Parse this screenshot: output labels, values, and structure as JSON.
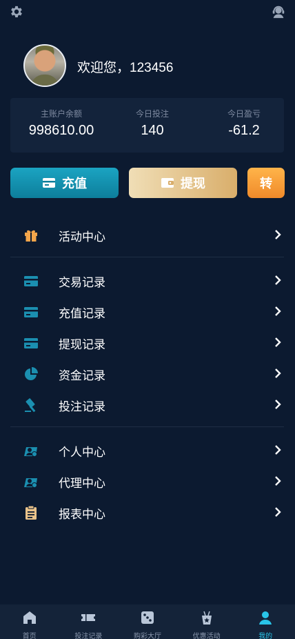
{
  "colors": {
    "background": "#0c1a30",
    "card": "#13233b",
    "accent_teal": "#1ba4c2",
    "gold": "#d9ae6b",
    "orange": "#f08a2a",
    "tab_active": "#29c4e8"
  },
  "header": {
    "settings_icon": "gear-icon",
    "support_icon": "customer-service-icon"
  },
  "profile": {
    "welcome": "欢迎您，123456"
  },
  "stats": [
    {
      "label": "主账户余额",
      "value": "998610.00"
    },
    {
      "label": "今日投注",
      "value": "140"
    },
    {
      "label": "今日盈亏",
      "value": "-61.2"
    }
  ],
  "actions": {
    "recharge": "充值",
    "withdraw": "提现",
    "transfer": "转"
  },
  "menu": [
    {
      "label": "活动中心",
      "icon": "gift-icon"
    },
    {
      "label": "交易记录",
      "icon": "card-icon"
    },
    {
      "label": "充值记录",
      "icon": "card-icon"
    },
    {
      "label": "提现记录",
      "icon": "card-icon"
    },
    {
      "label": "资金记录",
      "icon": "pie-chart-icon"
    },
    {
      "label": "投注记录",
      "icon": "gavel-icon"
    },
    {
      "label": "个人中心",
      "icon": "user-card-icon"
    },
    {
      "label": "代理中心",
      "icon": "user-card-icon"
    },
    {
      "label": "报表中心",
      "icon": "clipboard-icon"
    }
  ],
  "tabbar": [
    {
      "label": "首页",
      "icon": "home-icon"
    },
    {
      "label": "投注记录",
      "icon": "ticket-icon"
    },
    {
      "label": "购彩大厅",
      "icon": "dice-icon"
    },
    {
      "label": "优惠活动",
      "icon": "promo-icon"
    },
    {
      "label": "我的",
      "icon": "user-icon",
      "active": true
    }
  ]
}
